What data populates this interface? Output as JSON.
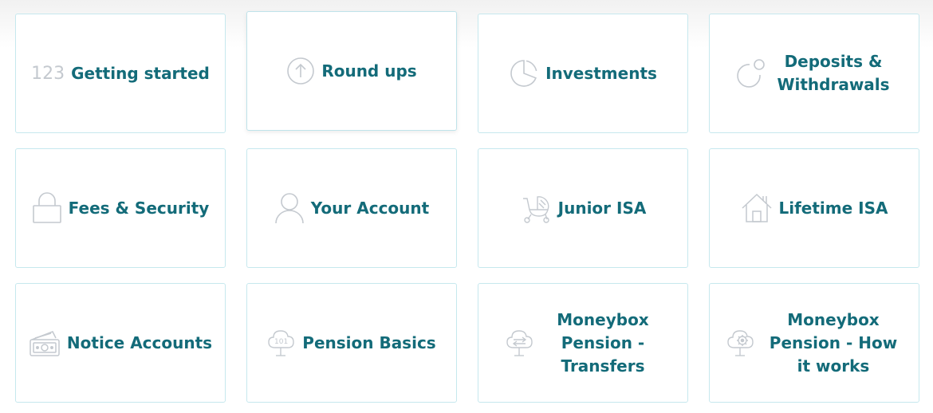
{
  "cards": [
    {
      "label": "Getting started",
      "icon": "numbers-123-icon",
      "icon_text": "123"
    },
    {
      "label": "Round ups",
      "icon": "arrow-up-circle-icon"
    },
    {
      "label": "Investments",
      "icon": "pie-chart-icon"
    },
    {
      "label": "Deposits & Withdrawals",
      "icon": "coin-circle-icon"
    },
    {
      "label": "Fees & Security",
      "icon": "padlock-icon"
    },
    {
      "label": "Your Account",
      "icon": "user-icon"
    },
    {
      "label": "Junior ISA",
      "icon": "pram-icon"
    },
    {
      "label": "Lifetime ISA",
      "icon": "house-icon"
    },
    {
      "label": "Notice Accounts",
      "icon": "cash-icon"
    },
    {
      "label": "Pension Basics",
      "icon": "tree-101-icon",
      "icon_text": "101"
    },
    {
      "label": "Moneybox Pension - Transfers",
      "icon": "tree-transfer-icon"
    },
    {
      "label": "Moneybox Pension - How it works",
      "icon": "tree-gear-icon"
    }
  ],
  "colors": {
    "label": "#136b79",
    "icon": "#c4c9cf",
    "border": "#c6e8ee"
  }
}
